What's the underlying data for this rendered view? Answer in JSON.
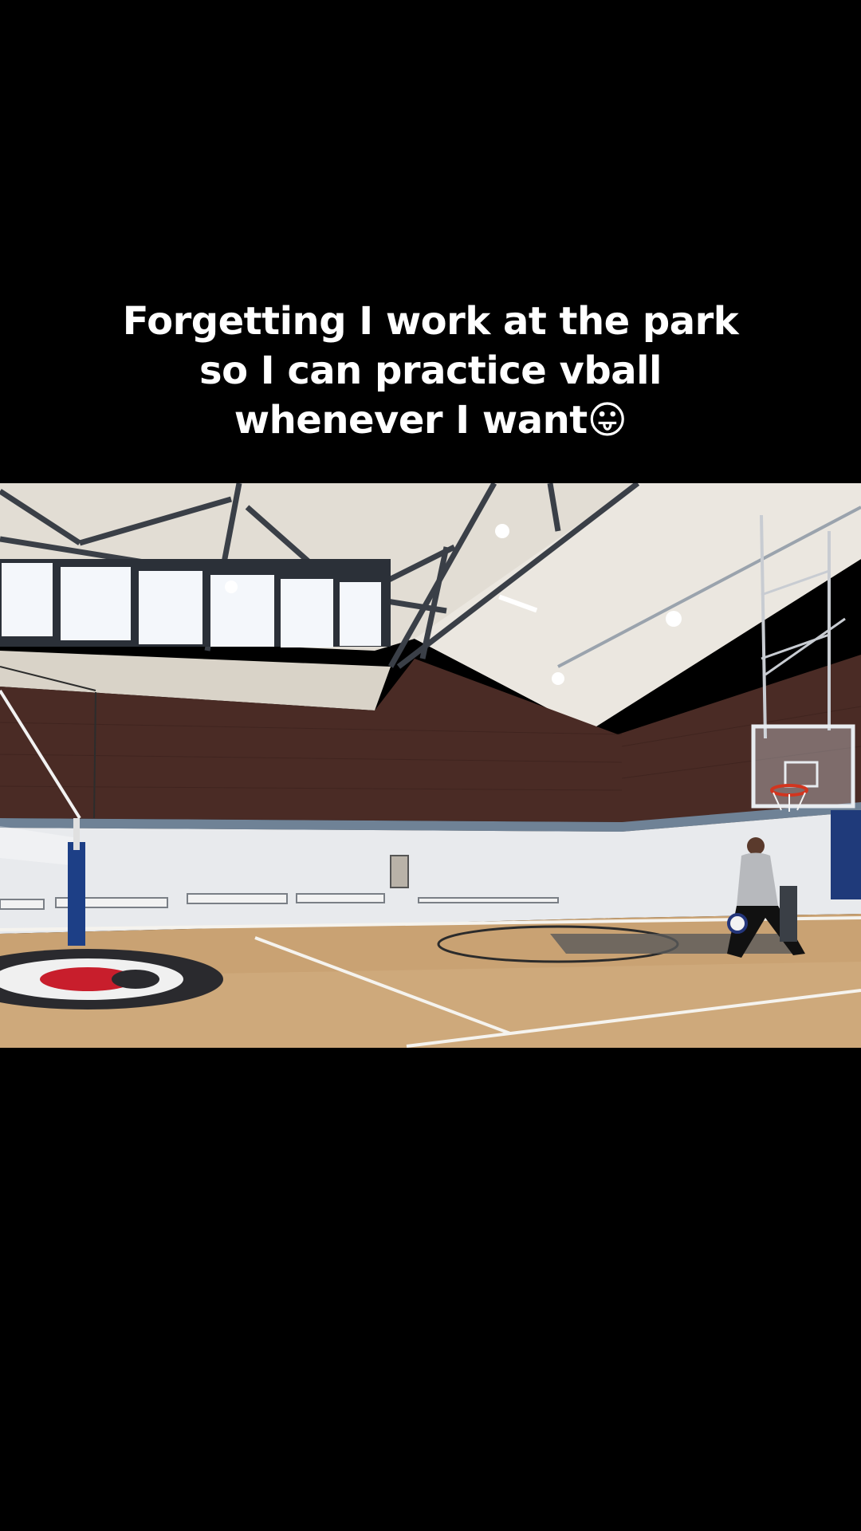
{
  "caption": {
    "line1": "Forgetting I work at the park",
    "line2": "so I can practice vball",
    "line3": "whenever I want😛"
  },
  "scene": {
    "description_icons": [
      "gym-ceiling",
      "clerestory-windows",
      "brick-wall",
      "basketball-hoop",
      "volleyball-net",
      "benches",
      "player",
      "volleyball",
      "court-floor",
      "center-court-logo"
    ]
  },
  "colors": {
    "background": "#000000",
    "caption_text": "#ffffff",
    "floor": "#c9a273",
    "brick": "#4a2a24",
    "wall_white": "#e9ebee",
    "wall_stripe": "#6f8296",
    "ceiling": "#e4e0d8",
    "net_post": "#1d3f86"
  }
}
